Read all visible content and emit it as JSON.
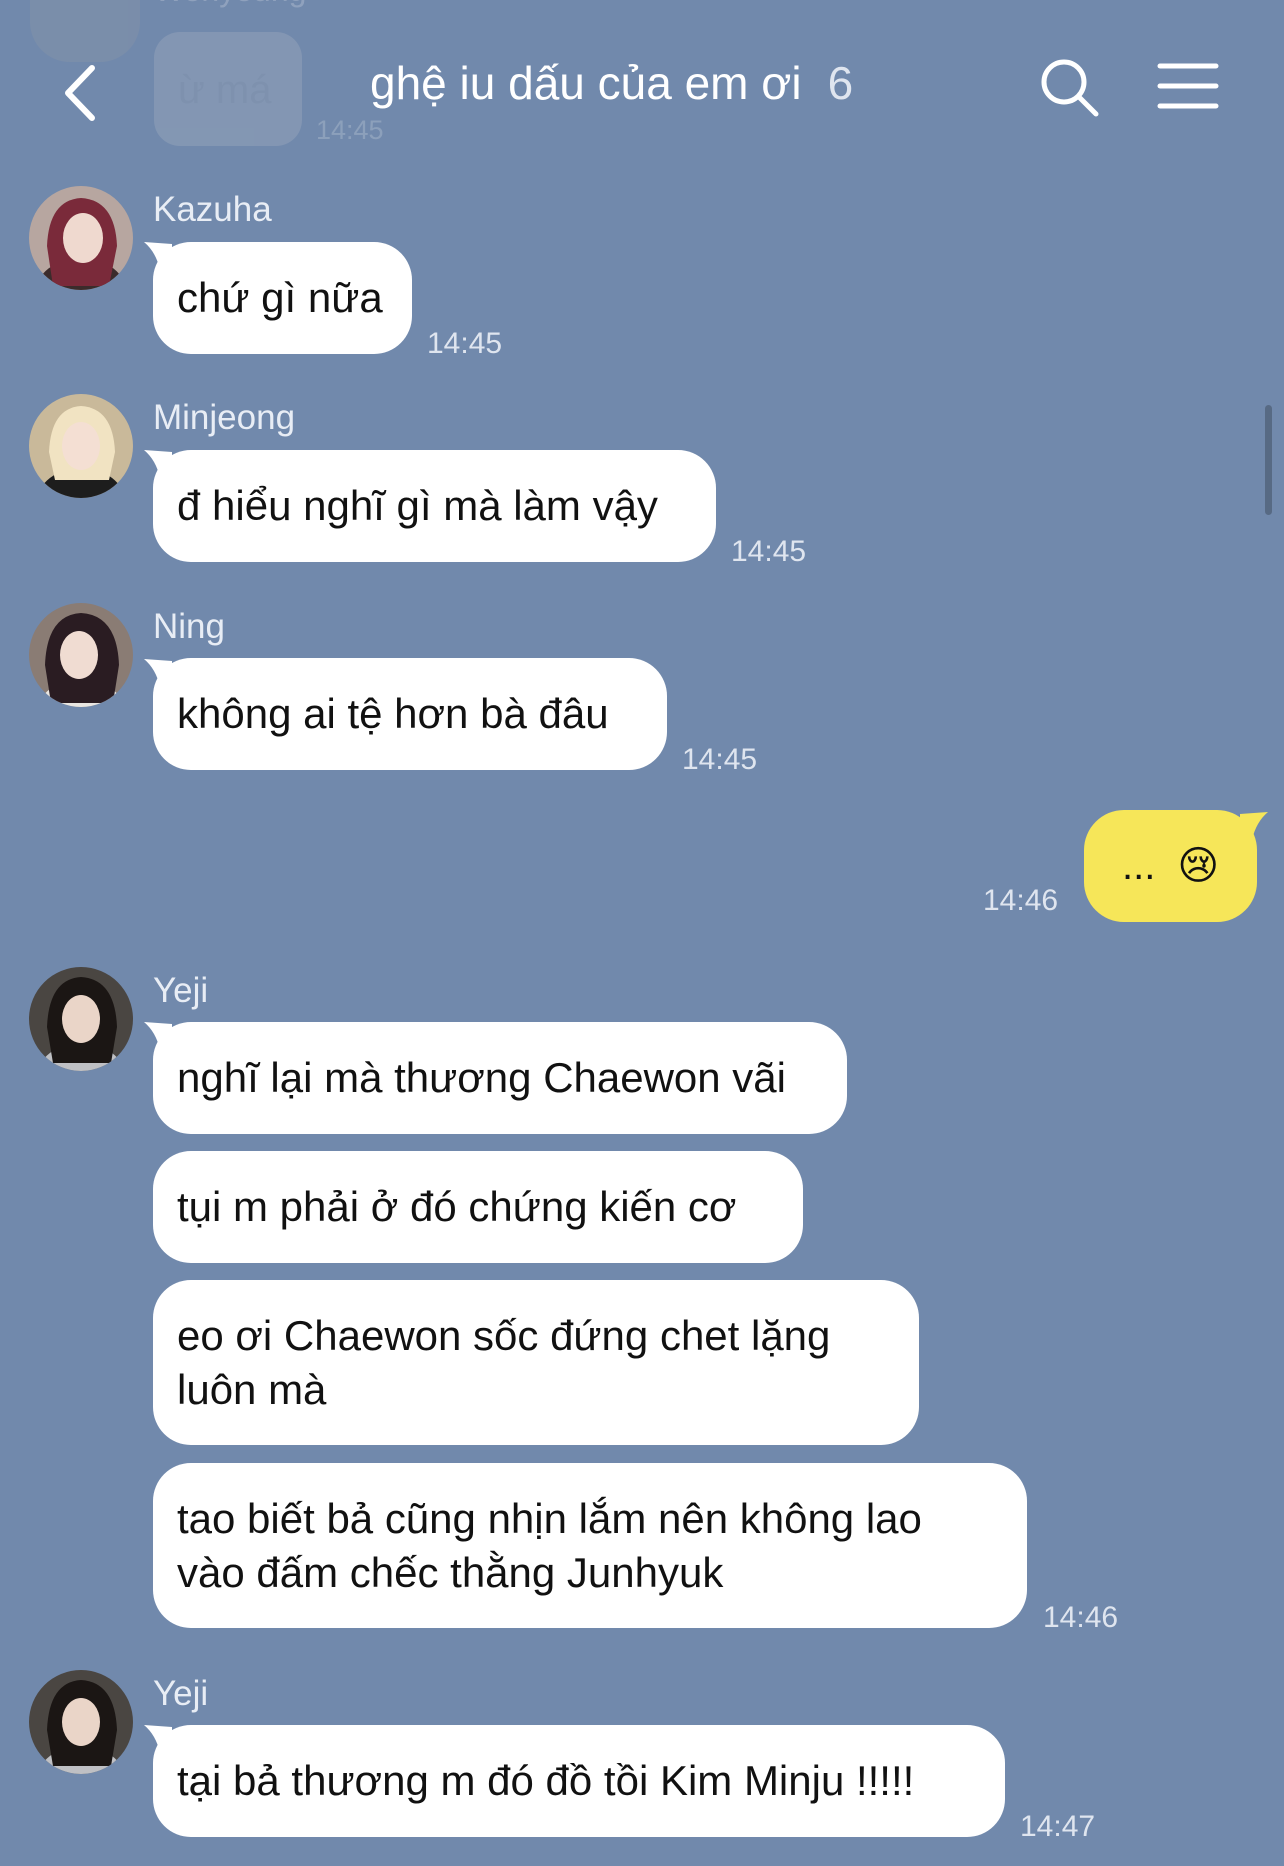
{
  "colors": {
    "background": "#7189ac",
    "bubble_in": "#ffffff",
    "bubble_out": "#f6e659"
  },
  "header": {
    "back_icon": "chevron-left-icon",
    "title": "ghệ iu dấu của em ơi",
    "member_count": "6",
    "search_icon": "search-icon",
    "menu_icon": "hamburger-menu-icon"
  },
  "ghost_message": {
    "sender": "Wonyoung",
    "text": "ừ má",
    "time": "14:45"
  },
  "messages": [
    {
      "sender": "Kazuha",
      "text": "chứ gì nữa",
      "time": "14:45"
    },
    {
      "sender": "Minjeong",
      "text": "đ hiểu nghĩ gì mà làm vậy",
      "time": "14:45"
    },
    {
      "sender": "Ning",
      "text": "không ai tệ hơn bà đâu",
      "time": "14:45"
    }
  ],
  "my_message": {
    "text": "...",
    "emoji": "😢",
    "time": "14:46"
  },
  "yeji_group": {
    "sender": "Yeji",
    "bubbles": [
      "nghĩ lại mà thương Chaewon vãi",
      "tụi m phải ở đó chứng kiến cơ",
      "eo ơi Chaewon sốc đứng chet lặng\nluôn mà",
      "tao biết bả cũng nhịn lắm nên không lao\nvào đấm chếc thằng Junhyuk"
    ],
    "time": "14:46"
  },
  "last_message": {
    "sender": "Yeji",
    "text": "tại bả thương m đó đồ tồi Kim Minju !!!!!",
    "time": "14:47"
  }
}
